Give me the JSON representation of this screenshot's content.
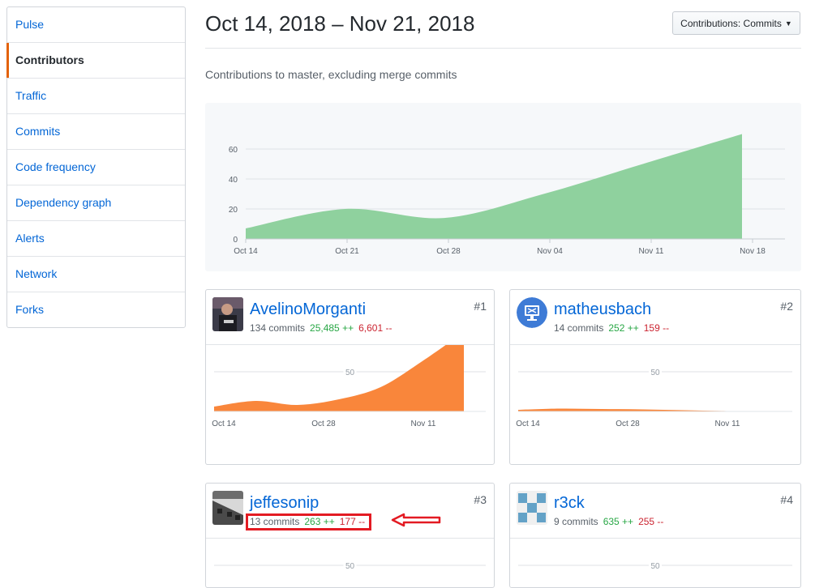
{
  "sidebar": {
    "items": [
      {
        "label": "Pulse",
        "selected": false
      },
      {
        "label": "Contributors",
        "selected": true
      },
      {
        "label": "Traffic",
        "selected": false
      },
      {
        "label": "Commits",
        "selected": false
      },
      {
        "label": "Code frequency",
        "selected": false
      },
      {
        "label": "Dependency graph",
        "selected": false
      },
      {
        "label": "Alerts",
        "selected": false
      },
      {
        "label": "Network",
        "selected": false
      },
      {
        "label": "Forks",
        "selected": false
      }
    ]
  },
  "header": {
    "title": "Oct 14, 2018 – Nov 21, 2018",
    "dropdown_label": "Contributions: Commits"
  },
  "subtitle": "Contributions to master, excluding merge commits",
  "colors": {
    "main_area": "#8fd19e",
    "contributor_area": "#f9863b",
    "link": "#0366d6",
    "additions": "#28a745",
    "deletions": "#cb2431",
    "highlight": "#e31b23"
  },
  "chart_data": [
    {
      "type": "area",
      "title": "",
      "x": [
        "Oct 14",
        "Oct 21",
        "Oct 28",
        "Nov 04",
        "Nov 11",
        "Nov 18"
      ],
      "y_ticks": [
        "0",
        "20",
        "40",
        "60"
      ],
      "ylim": [
        0,
        80
      ],
      "series": [
        {
          "values": [
            7,
            20,
            14,
            30,
            50,
            70
          ]
        }
      ],
      "grid": true
    }
  ],
  "contributors": [
    {
      "login": "AvelinoMorganti",
      "commits": "134 commits",
      "additions": "25,485 ++",
      "deletions": "6,601 --",
      "rank": "#1",
      "avatar": "photo",
      "x_labels": [
        "Oct 14",
        "Oct 28",
        "Nov 11"
      ],
      "y_tick": "50",
      "values": [
        6,
        13,
        8,
        15,
        30,
        62,
        98
      ]
    },
    {
      "login": "matheusbach",
      "commits": "14 commits",
      "additions": "252 ++",
      "deletions": "159 --",
      "rank": "#2",
      "avatar": "monitor-icon",
      "x_labels": [
        "Oct 14",
        "Oct 28",
        "Nov 11"
      ],
      "y_tick": "50",
      "values": [
        2,
        3.5,
        3,
        2.5,
        1.5,
        0.5,
        0
      ]
    },
    {
      "login": "jeffesonip",
      "commits": "13 commits",
      "additions": "263 ++",
      "deletions": "177 --",
      "rank": "#3",
      "avatar": "photo-bw",
      "x_labels": [],
      "y_tick": "50",
      "values": []
    },
    {
      "login": "r3ck",
      "commits": "9 commits",
      "additions": "635 ++",
      "deletions": "255 --",
      "rank": "#4",
      "avatar": "identicon",
      "x_labels": [],
      "y_tick": "50",
      "values": []
    }
  ]
}
